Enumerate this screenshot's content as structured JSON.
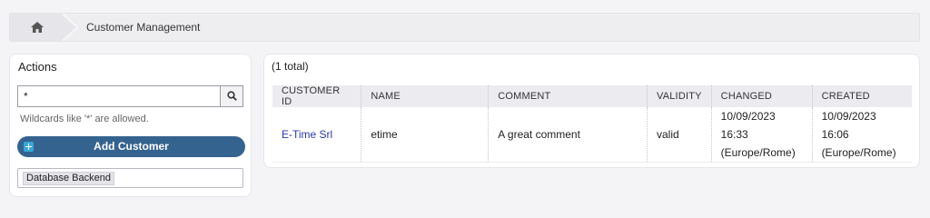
{
  "breadcrumb": {
    "home_icon": "home-icon",
    "current": "Customer Management"
  },
  "sidebar": {
    "title": "Actions",
    "search": {
      "value": "*",
      "button_icon": "search-icon"
    },
    "hint": "Wildcards like '*' are allowed.",
    "add_button": {
      "label": "Add Customer",
      "icon": "plus-icon"
    },
    "backend_tag": "Database Backend"
  },
  "main": {
    "total": "(1 total)",
    "columns": [
      "CUSTOMER ID",
      "NAME",
      "COMMENT",
      "VALIDITY",
      "CHANGED",
      "CREATED"
    ],
    "rows": [
      {
        "customer_id": "E-Time Srl",
        "name": "etime",
        "comment": "A great comment",
        "validity": "valid",
        "changed": {
          "date": "10/09/2023",
          "time": "16:33",
          "tz": "(Europe/Rome)"
        },
        "created": {
          "date": "10/09/2023",
          "time": "16:06",
          "tz": "(Europe/Rome)"
        }
      }
    ]
  },
  "colors": {
    "accent": "#35638f",
    "link": "#2b3aa8",
    "plus": "#38a7d6"
  }
}
